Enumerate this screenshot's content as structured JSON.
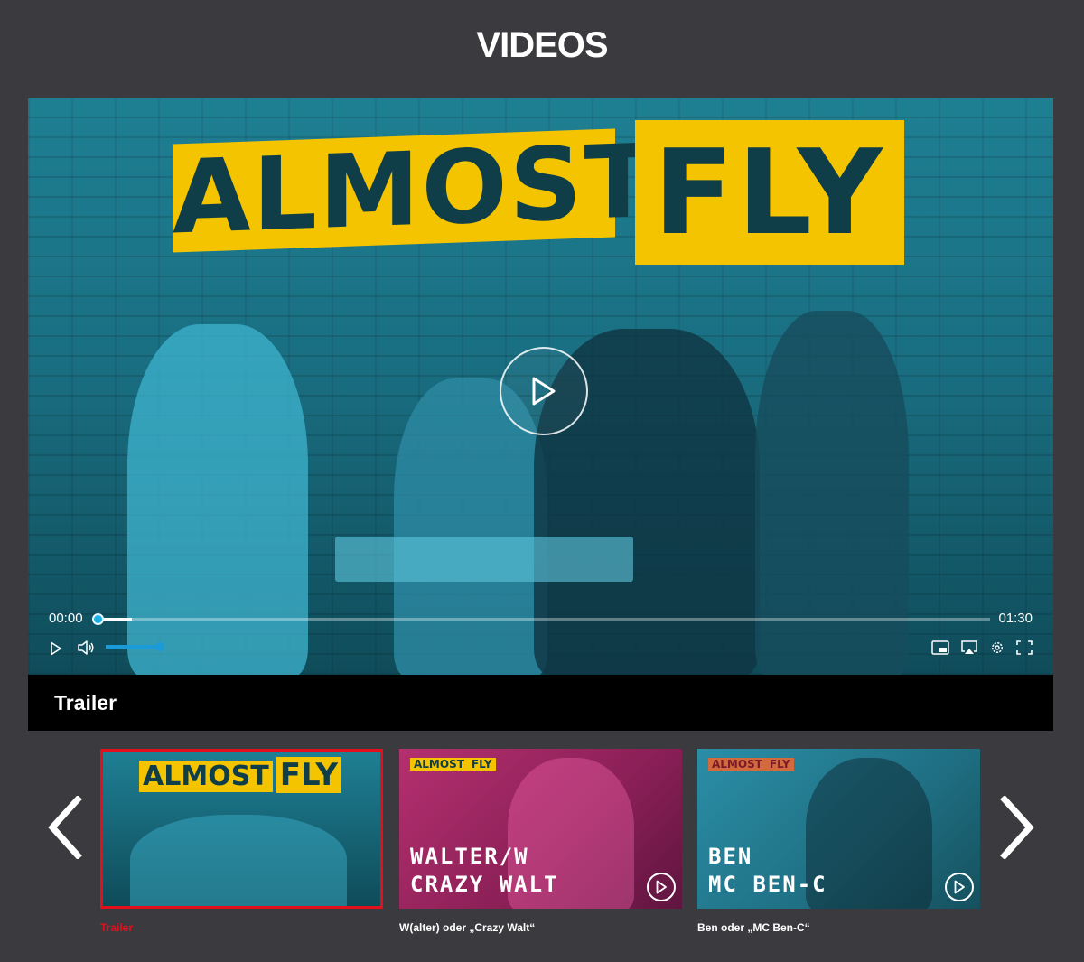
{
  "page": {
    "title": "VIDEOS"
  },
  "player": {
    "logo_word_1": "ALMOST",
    "logo_word_2": "FLY",
    "time_current": "00:00",
    "time_total": "01:30",
    "progress_fraction": 0.04,
    "volume_fraction": 1.0,
    "caption": "Trailer"
  },
  "controls": {
    "play_icon": "play-icon",
    "volume_icon": "volume-icon",
    "pip_icon": "picture-in-picture-icon",
    "airplay_icon": "airplay-icon",
    "settings_icon": "gear-icon",
    "fullscreen_icon": "fullscreen-icon"
  },
  "carousel": {
    "items": [
      {
        "logo_1": "ALMOST",
        "logo_2": "FLY",
        "headline_1": "",
        "headline_2": "",
        "caption": "Trailer",
        "active": true
      },
      {
        "logo_1": "ALMOST",
        "logo_2": "FLY",
        "headline_1": "WALTER/W",
        "headline_2": "CRAZY WALT",
        "caption": "W(alter) oder „Crazy Walt“",
        "active": false
      },
      {
        "logo_1": "ALMOST",
        "logo_2": "FLY",
        "headline_1": "BEN",
        "headline_2": "MC BEN-C",
        "caption": "Ben oder „MC Ben-C“",
        "active": false
      }
    ]
  },
  "colors": {
    "accent_red": "#e1101a",
    "accent_blue": "#1a9ad6",
    "logo_yellow": "#f5c400",
    "background": "#3b3a3f"
  }
}
